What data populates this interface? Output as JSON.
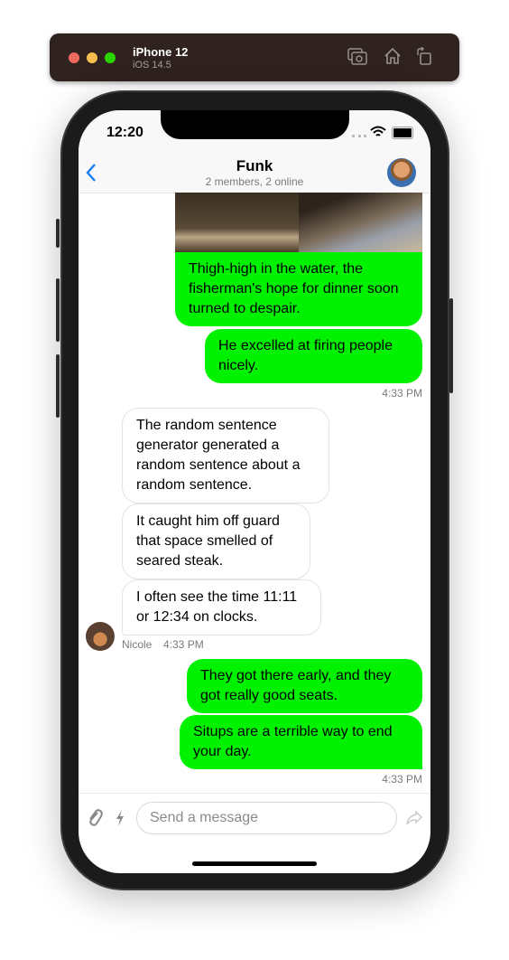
{
  "simulator": {
    "device": "iPhone 12",
    "os": "iOS 14.5",
    "icons": [
      "screenshot-icon",
      "home-icon",
      "rotate-icon"
    ]
  },
  "status_bar": {
    "time": "12:20"
  },
  "header": {
    "title": "Funk",
    "subtitle": "2 members, 2 online"
  },
  "messages": [
    {
      "side": "right",
      "text": "Thigh-high in the water, the fisherman's hope for dinner soon turned to despair.",
      "has_image": true
    },
    {
      "side": "right",
      "text": "He excelled at firing people nicely."
    },
    {
      "side": "right",
      "time": "4:33 PM"
    },
    {
      "side": "left",
      "text": "The random sentence generator generated a random sentence about a random sentence."
    },
    {
      "side": "left",
      "text": "It caught him off guard that space smelled of seared steak."
    },
    {
      "side": "left",
      "text": "I often see the time 11:11 or 12:34 on clocks."
    },
    {
      "side": "left",
      "author": "Nicole",
      "time": "4:33 PM"
    },
    {
      "side": "right",
      "text": "They got there early, and they got really good seats."
    },
    {
      "side": "right",
      "text": "Situps are a terrible way to end your day."
    },
    {
      "side": "right",
      "time": "4:33 PM"
    }
  ],
  "composer": {
    "placeholder": "Send a message"
  },
  "colors": {
    "own_bubble": "#00f200",
    "accent": "#1a7cf5"
  }
}
